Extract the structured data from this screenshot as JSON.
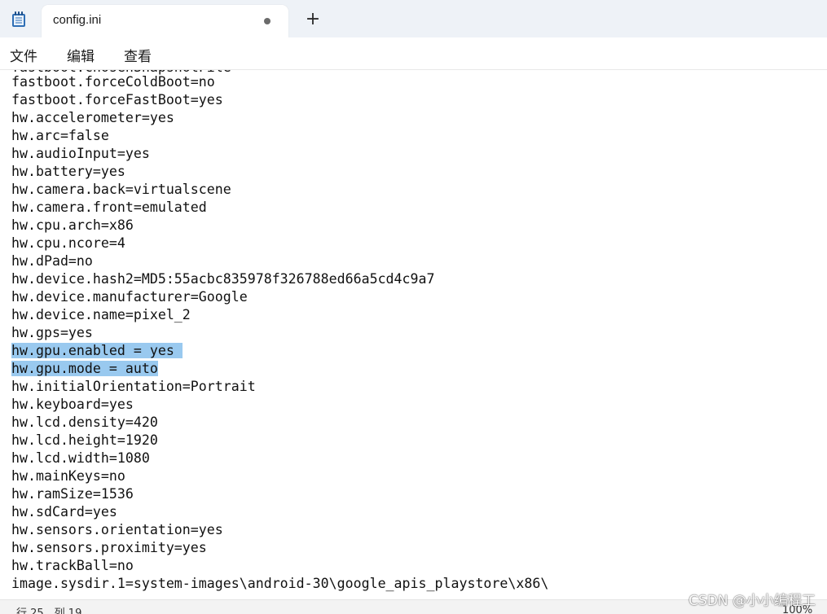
{
  "tab": {
    "title": "config.ini",
    "new_tab_label": "+"
  },
  "menu": {
    "items": [
      "文件",
      "编辑",
      "查看"
    ]
  },
  "editor": {
    "partial_top_line": "fastboot.chosenSnapshotFile=",
    "lines": [
      "fastboot.forceColdBoot=no",
      "fastboot.forceFastBoot=yes",
      "hw.accelerometer=yes",
      "hw.arc=false",
      "hw.audioInput=yes",
      "hw.battery=yes",
      "hw.camera.back=virtualscene",
      "hw.camera.front=emulated",
      "hw.cpu.arch=x86",
      "hw.cpu.ncore=4",
      "hw.dPad=no",
      "hw.device.hash2=MD5:55acbc835978f326788ed66a5cd4c9a7",
      "hw.device.manufacturer=Google",
      "hw.device.name=pixel_2",
      "hw.gps=yes",
      "hw.gpu.enabled = yes ",
      "hw.gpu.mode = auto",
      "hw.initialOrientation=Portrait",
      "hw.keyboard=yes",
      "hw.lcd.density=420",
      "hw.lcd.height=1920",
      "hw.lcd.width=1080",
      "hw.mainKeys=no",
      "hw.ramSize=1536",
      "hw.sdCard=yes",
      "hw.sensors.orientation=yes",
      "hw.sensors.proximity=yes",
      "hw.trackBall=no",
      "image.sysdir.1=system-images\\android-30\\google_apis_playstore\\x86\\"
    ],
    "selected_lines": [
      15,
      16
    ]
  },
  "status": {
    "position": "行 25，列 19",
    "zoom": "100%"
  },
  "watermark": "CSDN @小小编程工",
  "colors": {
    "selection": "#99c9ef",
    "titlebar": "#eef2f7"
  },
  "icons": {
    "app": "notepad-icon",
    "new_tab": "plus-icon",
    "tab_modified": "unsaved-dot-icon"
  }
}
